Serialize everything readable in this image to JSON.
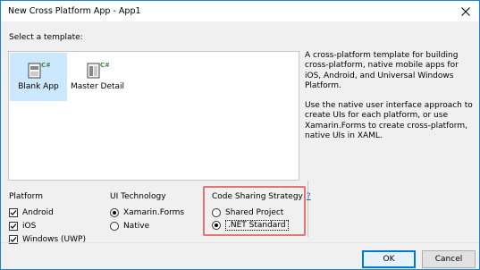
{
  "window": {
    "title": "New Cross Platform App - App1"
  },
  "templates": {
    "label": "Select a template:",
    "items": [
      {
        "label": "Blank App",
        "selected": true
      },
      {
        "label": "Master Detail",
        "selected": false
      }
    ],
    "description": [
      "A cross-platform template for building cross-platform, native mobile apps for iOS, Android, and Universal Windows Platform.",
      "Use the native user interface approach to create UIs for each platform, or use Xamarin.Forms to create cross-platform, native UIs in XAML."
    ]
  },
  "platform": {
    "title": "Platform",
    "options": [
      {
        "label": "Android",
        "checked": true
      },
      {
        "label": "iOS",
        "checked": true
      },
      {
        "label": "Windows (UWP)",
        "checked": true
      }
    ]
  },
  "ui_technology": {
    "title": "UI Technology",
    "options": [
      {
        "label": "Xamarin.Forms",
        "selected": true
      },
      {
        "label": "Native",
        "selected": false
      }
    ]
  },
  "code_sharing": {
    "title": "Code Sharing Strategy",
    "help": "?",
    "options": [
      {
        "label": "Shared Project",
        "selected": false
      },
      {
        "label": ".NET Standard",
        "selected": true
      }
    ]
  },
  "buttons": {
    "ok": "OK",
    "cancel": "Cancel"
  },
  "colors": {
    "accent": "#0078d7",
    "highlight_box": "#e57373",
    "selection": "#cce8ff",
    "csharp_badge": "#3c8a3c"
  }
}
